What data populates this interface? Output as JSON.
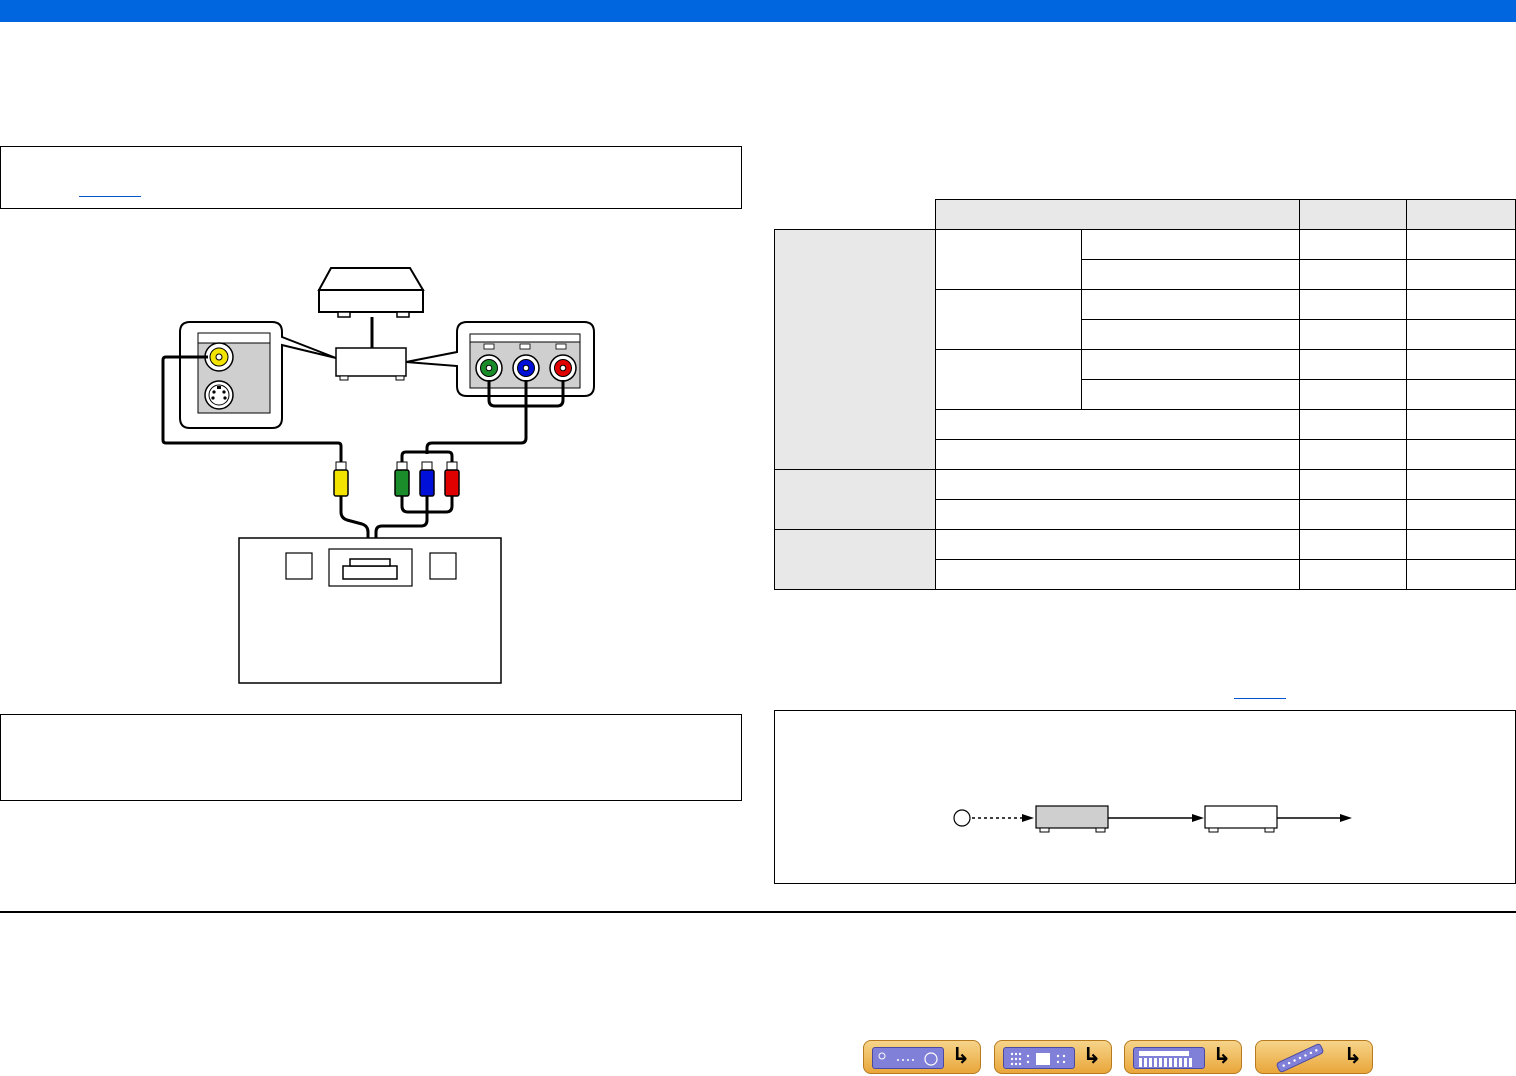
{
  "colors": {
    "topbar": "#0066e0",
    "video_plug": "#f2e400",
    "component_green": "#1a8c2a",
    "component_blue": "#0010d8",
    "component_red": "#e00000",
    "link": "#0055cc",
    "table_header_fill": "#e8e8e8",
    "nav_button": "#e9a63a"
  },
  "icons": {
    "video_jack": "yellow-rca-jack-icon",
    "s_video_jack": "s-video-jack-icon",
    "component_jacks": "green-blue-red-rca-jack-icons",
    "source_device": "video-source-device-icon",
    "receiver_panel": "receiver-rear-panel-icon",
    "flow_circle": "signal-source-circle-icon",
    "flow_device_1": "flow-device-gray-icon",
    "flow_device_2": "flow-device-white-icon",
    "nav_receiver_front": "receiver-front-icon",
    "nav_receiver_rear": "receiver-rear-icon",
    "nav_menu_map": "menu-map-icon",
    "nav_remote": "remote-control-icon"
  },
  "table": {
    "rows": 12,
    "columns": 5
  },
  "nav": {
    "buttons": [
      "receiver-front",
      "receiver-rear",
      "menu-map",
      "remote-control"
    ]
  }
}
